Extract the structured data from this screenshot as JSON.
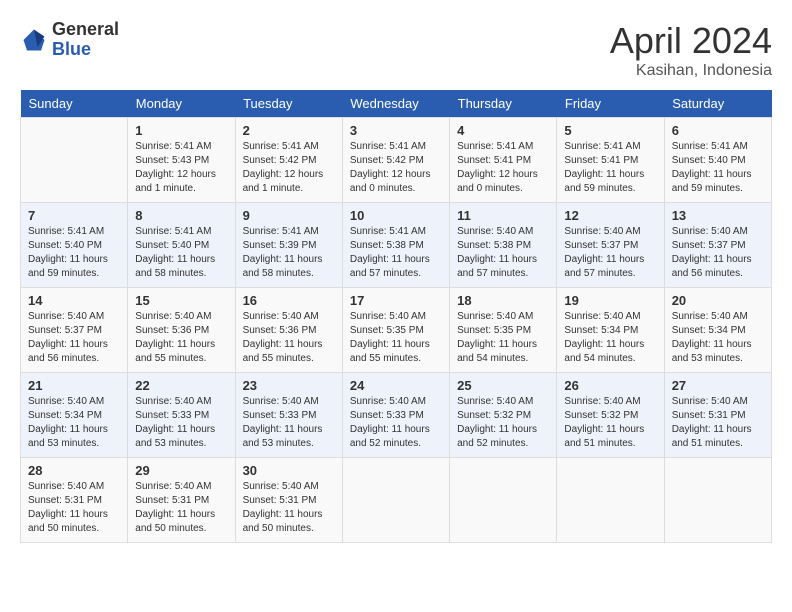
{
  "header": {
    "logo_line1": "General",
    "logo_line2": "Blue",
    "month": "April 2024",
    "location": "Kasihan, Indonesia"
  },
  "weekdays": [
    "Sunday",
    "Monday",
    "Tuesday",
    "Wednesday",
    "Thursday",
    "Friday",
    "Saturday"
  ],
  "weeks": [
    [
      {
        "day": "",
        "sunrise": "",
        "sunset": "",
        "daylight": ""
      },
      {
        "day": "1",
        "sunrise": "Sunrise: 5:41 AM",
        "sunset": "Sunset: 5:43 PM",
        "daylight": "Daylight: 12 hours and 1 minute."
      },
      {
        "day": "2",
        "sunrise": "Sunrise: 5:41 AM",
        "sunset": "Sunset: 5:42 PM",
        "daylight": "Daylight: 12 hours and 1 minute."
      },
      {
        "day": "3",
        "sunrise": "Sunrise: 5:41 AM",
        "sunset": "Sunset: 5:42 PM",
        "daylight": "Daylight: 12 hours and 0 minutes."
      },
      {
        "day": "4",
        "sunrise": "Sunrise: 5:41 AM",
        "sunset": "Sunset: 5:41 PM",
        "daylight": "Daylight: 12 hours and 0 minutes."
      },
      {
        "day": "5",
        "sunrise": "Sunrise: 5:41 AM",
        "sunset": "Sunset: 5:41 PM",
        "daylight": "Daylight: 11 hours and 59 minutes."
      },
      {
        "day": "6",
        "sunrise": "Sunrise: 5:41 AM",
        "sunset": "Sunset: 5:40 PM",
        "daylight": "Daylight: 11 hours and 59 minutes."
      }
    ],
    [
      {
        "day": "7",
        "sunrise": "Sunrise: 5:41 AM",
        "sunset": "Sunset: 5:40 PM",
        "daylight": "Daylight: 11 hours and 59 minutes."
      },
      {
        "day": "8",
        "sunrise": "Sunrise: 5:41 AM",
        "sunset": "Sunset: 5:40 PM",
        "daylight": "Daylight: 11 hours and 58 minutes."
      },
      {
        "day": "9",
        "sunrise": "Sunrise: 5:41 AM",
        "sunset": "Sunset: 5:39 PM",
        "daylight": "Daylight: 11 hours and 58 minutes."
      },
      {
        "day": "10",
        "sunrise": "Sunrise: 5:41 AM",
        "sunset": "Sunset: 5:38 PM",
        "daylight": "Daylight: 11 hours and 57 minutes."
      },
      {
        "day": "11",
        "sunrise": "Sunrise: 5:40 AM",
        "sunset": "Sunset: 5:38 PM",
        "daylight": "Daylight: 11 hours and 57 minutes."
      },
      {
        "day": "12",
        "sunrise": "Sunrise: 5:40 AM",
        "sunset": "Sunset: 5:37 PM",
        "daylight": "Daylight: 11 hours and 57 minutes."
      },
      {
        "day": "13",
        "sunrise": "Sunrise: 5:40 AM",
        "sunset": "Sunset: 5:37 PM",
        "daylight": "Daylight: 11 hours and 56 minutes."
      }
    ],
    [
      {
        "day": "14",
        "sunrise": "Sunrise: 5:40 AM",
        "sunset": "Sunset: 5:37 PM",
        "daylight": "Daylight: 11 hours and 56 minutes."
      },
      {
        "day": "15",
        "sunrise": "Sunrise: 5:40 AM",
        "sunset": "Sunset: 5:36 PM",
        "daylight": "Daylight: 11 hours and 55 minutes."
      },
      {
        "day": "16",
        "sunrise": "Sunrise: 5:40 AM",
        "sunset": "Sunset: 5:36 PM",
        "daylight": "Daylight: 11 hours and 55 minutes."
      },
      {
        "day": "17",
        "sunrise": "Sunrise: 5:40 AM",
        "sunset": "Sunset: 5:35 PM",
        "daylight": "Daylight: 11 hours and 55 minutes."
      },
      {
        "day": "18",
        "sunrise": "Sunrise: 5:40 AM",
        "sunset": "Sunset: 5:35 PM",
        "daylight": "Daylight: 11 hours and 54 minutes."
      },
      {
        "day": "19",
        "sunrise": "Sunrise: 5:40 AM",
        "sunset": "Sunset: 5:34 PM",
        "daylight": "Daylight: 11 hours and 54 minutes."
      },
      {
        "day": "20",
        "sunrise": "Sunrise: 5:40 AM",
        "sunset": "Sunset: 5:34 PM",
        "daylight": "Daylight: 11 hours and 53 minutes."
      }
    ],
    [
      {
        "day": "21",
        "sunrise": "Sunrise: 5:40 AM",
        "sunset": "Sunset: 5:34 PM",
        "daylight": "Daylight: 11 hours and 53 minutes."
      },
      {
        "day": "22",
        "sunrise": "Sunrise: 5:40 AM",
        "sunset": "Sunset: 5:33 PM",
        "daylight": "Daylight: 11 hours and 53 minutes."
      },
      {
        "day": "23",
        "sunrise": "Sunrise: 5:40 AM",
        "sunset": "Sunset: 5:33 PM",
        "daylight": "Daylight: 11 hours and 53 minutes."
      },
      {
        "day": "24",
        "sunrise": "Sunrise: 5:40 AM",
        "sunset": "Sunset: 5:33 PM",
        "daylight": "Daylight: 11 hours and 52 minutes."
      },
      {
        "day": "25",
        "sunrise": "Sunrise: 5:40 AM",
        "sunset": "Sunset: 5:32 PM",
        "daylight": "Daylight: 11 hours and 52 minutes."
      },
      {
        "day": "26",
        "sunrise": "Sunrise: 5:40 AM",
        "sunset": "Sunset: 5:32 PM",
        "daylight": "Daylight: 11 hours and 51 minutes."
      },
      {
        "day": "27",
        "sunrise": "Sunrise: 5:40 AM",
        "sunset": "Sunset: 5:31 PM",
        "daylight": "Daylight: 11 hours and 51 minutes."
      }
    ],
    [
      {
        "day": "28",
        "sunrise": "Sunrise: 5:40 AM",
        "sunset": "Sunset: 5:31 PM",
        "daylight": "Daylight: 11 hours and 50 minutes."
      },
      {
        "day": "29",
        "sunrise": "Sunrise: 5:40 AM",
        "sunset": "Sunset: 5:31 PM",
        "daylight": "Daylight: 11 hours and 50 minutes."
      },
      {
        "day": "30",
        "sunrise": "Sunrise: 5:40 AM",
        "sunset": "Sunset: 5:31 PM",
        "daylight": "Daylight: 11 hours and 50 minutes."
      },
      {
        "day": "",
        "sunrise": "",
        "sunset": "",
        "daylight": ""
      },
      {
        "day": "",
        "sunrise": "",
        "sunset": "",
        "daylight": ""
      },
      {
        "day": "",
        "sunrise": "",
        "sunset": "",
        "daylight": ""
      },
      {
        "day": "",
        "sunrise": "",
        "sunset": "",
        "daylight": ""
      }
    ]
  ]
}
